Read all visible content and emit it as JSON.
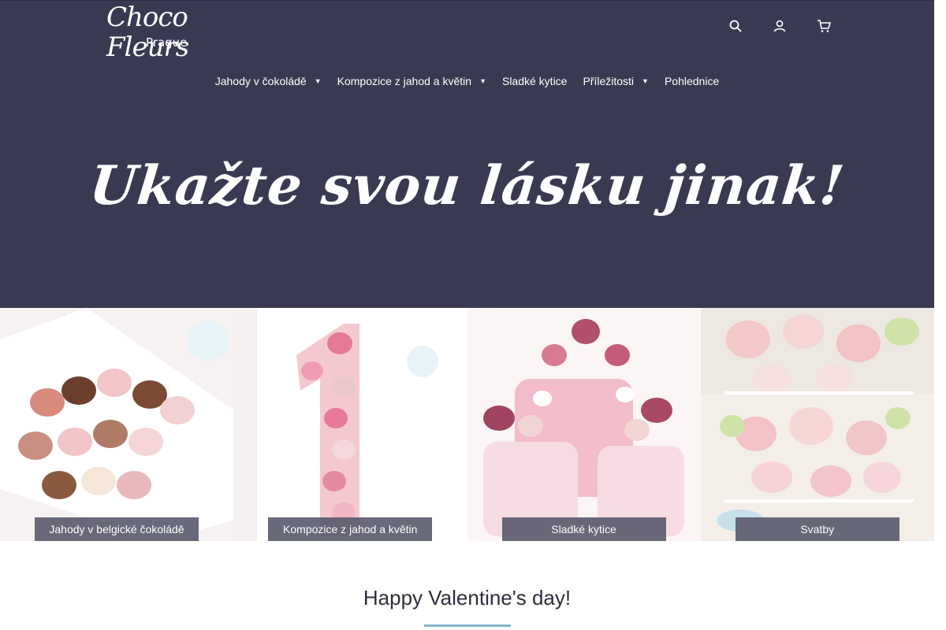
{
  "brand": {
    "logo_script": "Choco Fleurs",
    "logo_city": "Prague"
  },
  "header_icons": [
    "search-icon",
    "user-icon",
    "cart-icon"
  ],
  "nav": {
    "items": [
      {
        "label": "Jahody v čokoládě",
        "has_dropdown": true
      },
      {
        "label": "Kompozice z jahod a květin",
        "has_dropdown": true
      },
      {
        "label": "Sladké kytice",
        "has_dropdown": false
      },
      {
        "label": "Příležitosti",
        "has_dropdown": true
      },
      {
        "label": "Pohlednice",
        "has_dropdown": false
      }
    ]
  },
  "hero": {
    "headline": "Ukažte svou lásku jinak!"
  },
  "tiles": [
    {
      "label": "Jahody v belgické čokoládě"
    },
    {
      "label": "Kompozice z jahod a květin"
    },
    {
      "label": "Sladké kytice"
    },
    {
      "label": "Svatby"
    }
  ],
  "section": {
    "title": "Happy Valentine's day!"
  },
  "colors": {
    "header_bg": "#393a52",
    "label_bg": "#5c5d6e",
    "accent_line": "#7fb8c9"
  }
}
